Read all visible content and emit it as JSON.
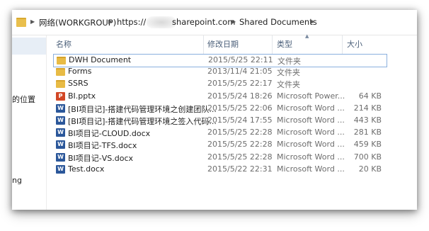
{
  "address_bar": {
    "crumbs": [
      "网络(WORKGROUP)",
      "https://",
      "sharepoint.com",
      "Shared Documents"
    ]
  },
  "nav_pane": {
    "items": [
      "",
      "",
      "的位置",
      "ng"
    ]
  },
  "columns": {
    "name": "名称",
    "date": "修改日期",
    "type": "类型",
    "size": "大小"
  },
  "files": [
    {
      "name": "DWH Document",
      "date": "2015/5/25 22:11",
      "type": "文件夹",
      "size": "",
      "icon": "folder-icon",
      "selected": true
    },
    {
      "name": "Forms",
      "date": "2013/11/4 21:05",
      "type": "文件夹",
      "size": "",
      "icon": "folder-icon"
    },
    {
      "name": "SSRS",
      "date": "2015/5/25 22:17",
      "type": "文件夹",
      "size": "",
      "icon": "folder-icon"
    },
    {
      "name": "BI.pptx",
      "date": "2015/5/24 18:26",
      "type": "Microsoft Power...",
      "size": "64 KB",
      "icon": "powerpoint-icon"
    },
    {
      "name": "[BI项目记]-搭建代码管理环境之创建团队...",
      "date": "2015/5/25 22:06",
      "type": "Microsoft Word ...",
      "size": "214 KB",
      "icon": "word-icon"
    },
    {
      "name": "[BI项目记]-搭建代码管理环境之签入代码...",
      "date": "2015/5/24 17:55",
      "type": "Microsoft Word ...",
      "size": "443 KB",
      "icon": "word-icon"
    },
    {
      "name": "BI项目记-CLOUD.docx",
      "date": "2015/5/25 22:28",
      "type": "Microsoft Word ...",
      "size": "281 KB",
      "icon": "word-icon"
    },
    {
      "name": "BI项目记-TFS.docx",
      "date": "2015/5/25 22:28",
      "type": "Microsoft Word ...",
      "size": "459 KB",
      "icon": "word-icon"
    },
    {
      "name": "BI项目记-VS.docx",
      "date": "2015/5/25 22:28",
      "type": "Microsoft Word ...",
      "size": "700 KB",
      "icon": "word-icon"
    },
    {
      "name": "Test.docx",
      "date": "2015/5/22 22:31",
      "type": "Microsoft Word ...",
      "size": "20 KB",
      "icon": "word-icon"
    }
  ],
  "colors": {
    "folder": "#e8bb45",
    "powerpoint": "#d24726",
    "word": "#2b579a",
    "selection_border": "#8bb0de",
    "header_text": "#4c607a"
  }
}
